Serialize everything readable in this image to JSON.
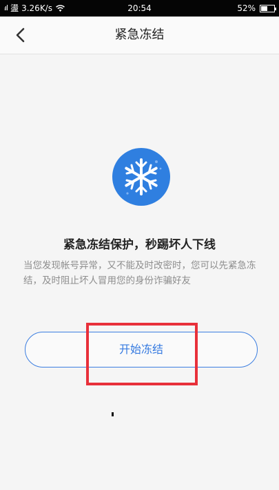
{
  "status_bar": {
    "signal": "ᵢıl",
    "carrier": "盪",
    "speed": "3.26K/s",
    "time": "20:54",
    "battery_text": "52%",
    "battery_level": 0.52,
    "wifi_icon": "wifi-icon"
  },
  "nav": {
    "back_icon": "chevron-left-icon",
    "title": "紧急冻结"
  },
  "main": {
    "icon": "snowflake-icon",
    "icon_color": "#2f7fe0",
    "headline": "紧急冻结保护，秒踢坏人下线",
    "description": "当您发现帐号异常，又不能及时改密时，您可以先紧急冻结，及时阻止坏人冒用您的身份诈骗好友",
    "button_label": "开始冻结",
    "highlight_color": "#e8303a"
  }
}
